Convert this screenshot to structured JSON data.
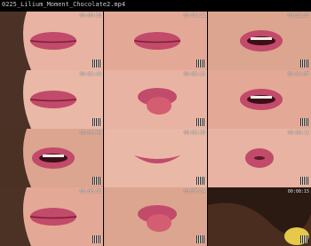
{
  "header": {
    "title": "0225_Lilium_Moment_Chocolate2.mp4"
  },
  "thumbnails": [
    {
      "timestamp": "00:00:38",
      "scene": "lips-closed"
    },
    {
      "timestamp": "00:01:21",
      "scene": "lips-closed"
    },
    {
      "timestamp": "00:02:03",
      "scene": "lips-open"
    },
    {
      "timestamp": "00:02:44",
      "scene": "lips-closed"
    },
    {
      "timestamp": "00:03:25",
      "scene": "tongue-out"
    },
    {
      "timestamp": "00:04:07",
      "scene": "lips-open"
    },
    {
      "timestamp": "00:04:48",
      "scene": "lips-open"
    },
    {
      "timestamp": "00:05:30",
      "scene": "smile"
    },
    {
      "timestamp": "00:06:11",
      "scene": "pucker"
    },
    {
      "timestamp": "00:06:52",
      "scene": "lips-closed"
    },
    {
      "timestamp": "00:07:34",
      "scene": "tongue-out"
    },
    {
      "timestamp": "00:08:15",
      "scene": "hair"
    }
  ]
}
